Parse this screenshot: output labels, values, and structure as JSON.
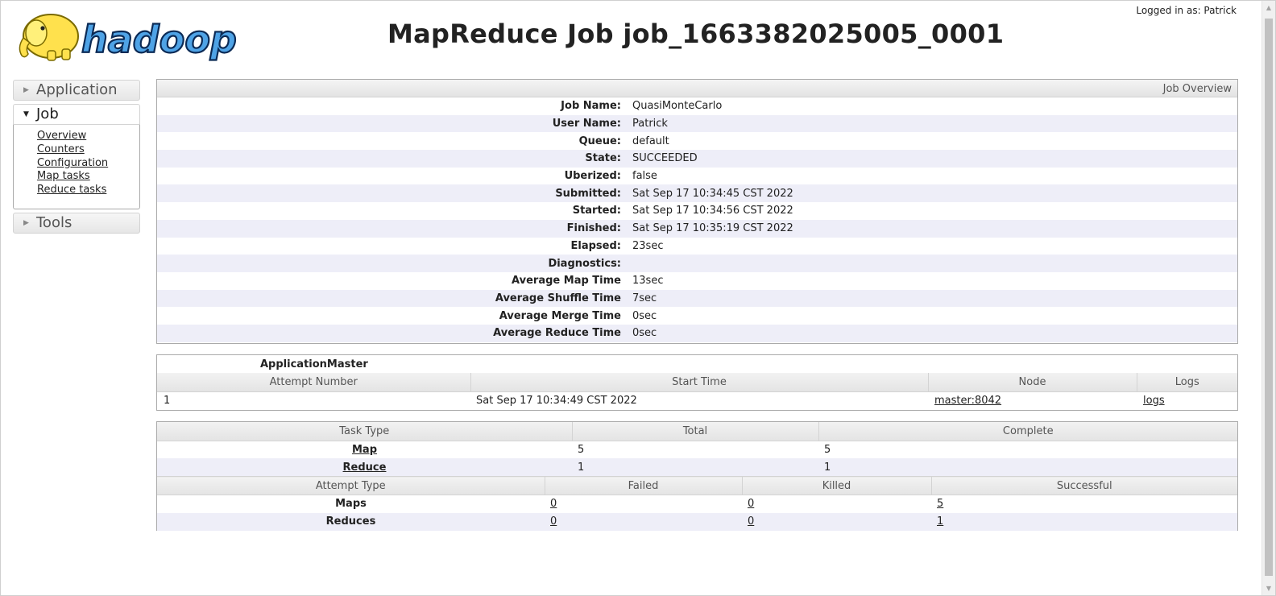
{
  "header": {
    "logo_text": "hadoop",
    "title": "MapReduce Job job_1663382025005_0001",
    "logged_in": "Logged in as: Patrick"
  },
  "sidebar": {
    "application": "Application",
    "job": "Job",
    "job_links": [
      "Overview",
      "Counters",
      "Configuration",
      "Map tasks",
      "Reduce tasks"
    ],
    "tools": "Tools"
  },
  "overview": {
    "heading": "Job Overview",
    "rows": [
      {
        "key": "Job Name:",
        "value": "QuasiMonteCarlo"
      },
      {
        "key": "User Name:",
        "value": "Patrick"
      },
      {
        "key": "Queue:",
        "value": "default"
      },
      {
        "key": "State:",
        "value": "SUCCEEDED"
      },
      {
        "key": "Uberized:",
        "value": "false"
      },
      {
        "key": "Submitted:",
        "value": "Sat Sep 17 10:34:45 CST 2022"
      },
      {
        "key": "Started:",
        "value": "Sat Sep 17 10:34:56 CST 2022"
      },
      {
        "key": "Finished:",
        "value": "Sat Sep 17 10:35:19 CST 2022"
      },
      {
        "key": "Elapsed:",
        "value": "23sec"
      },
      {
        "key": "Diagnostics:",
        "value": ""
      },
      {
        "key": "Average Map Time",
        "value": "13sec"
      },
      {
        "key": "Average Shuffle Time",
        "value": "7sec"
      },
      {
        "key": "Average Merge Time",
        "value": "0sec"
      },
      {
        "key": "Average Reduce Time",
        "value": "0sec"
      }
    ]
  },
  "app_master": {
    "title": "ApplicationMaster",
    "columns": [
      "Attempt Number",
      "Start Time",
      "Node",
      "Logs"
    ],
    "row": {
      "attempt": "1",
      "start": "Sat Sep 17 10:34:49 CST 2022",
      "node": "master:8042",
      "logs": "logs"
    }
  },
  "tasks": {
    "columns": [
      "Task Type",
      "Total",
      "Complete"
    ],
    "rows": [
      {
        "type": "Map",
        "total": "5",
        "complete": "5"
      },
      {
        "type": "Reduce",
        "total": "1",
        "complete": "1"
      }
    ]
  },
  "attempts": {
    "columns": [
      "Attempt Type",
      "Failed",
      "Killed",
      "Successful"
    ],
    "rows": [
      {
        "type": "Maps",
        "failed": "0",
        "killed": "0",
        "successful": "5"
      },
      {
        "type": "Reduces",
        "failed": "0",
        "killed": "0",
        "successful": "1"
      }
    ]
  }
}
